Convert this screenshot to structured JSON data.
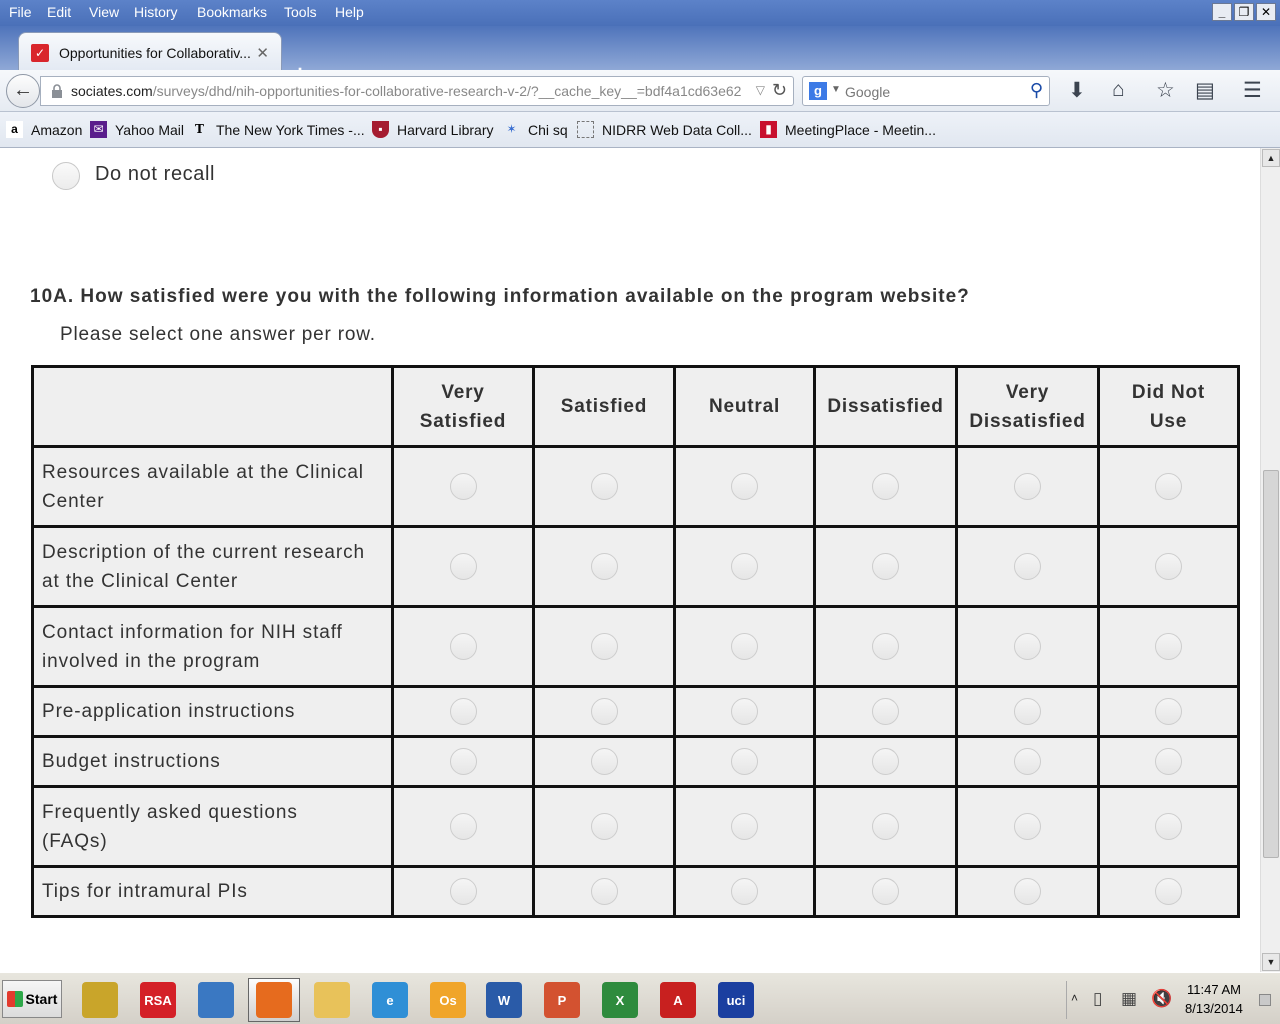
{
  "menu": {
    "items": [
      "File",
      "Edit",
      "View",
      "History",
      "Bookmarks",
      "Tools",
      "Help"
    ]
  },
  "window_controls": {
    "minimize": "_",
    "restore": "❐",
    "close": "✕"
  },
  "tab": {
    "title": "Opportunities for Collaborativ...",
    "close": "✕",
    "new_tab": "+"
  },
  "urlbar": {
    "host": "sociates.com",
    "path": "/surveys/dhd/nih-opportunities-for-collaborative-research-v-2/?__cache_key__=bdf4a1cd63e62"
  },
  "search": {
    "placeholder": "Google"
  },
  "bookmarks": [
    {
      "label": "Amazon",
      "icon": "amazon-icon"
    },
    {
      "label": "Yahoo Mail",
      "icon": "yahoo-mail-icon"
    },
    {
      "label": "The New York Times -...",
      "icon": "nyt-icon"
    },
    {
      "label": "Harvard Library",
      "icon": "harvard-shield-icon"
    },
    {
      "label": "Chi sq",
      "icon": "chi-sq-icon"
    },
    {
      "label": "NIDRR Web Data Coll...",
      "icon": "dashed-page-icon"
    },
    {
      "label": "MeetingPlace - Meetin...",
      "icon": "meetingplace-icon"
    }
  ],
  "page": {
    "previous_option": "Do not recall",
    "question": "10A. How satisfied were you with the following information available on the program website?",
    "instruction": "Please select one answer per row.",
    "columns": [
      [
        "Very",
        "Satisfied"
      ],
      [
        "Satisfied"
      ],
      [
        "Neutral"
      ],
      [
        "Dissatisfied"
      ],
      [
        "Very",
        "Dissatisfied"
      ],
      [
        "Did Not",
        "Use"
      ]
    ],
    "rows": [
      [
        "Resources available at the Clinical",
        "Center"
      ],
      [
        "Description of the current research",
        "at the Clinical Center"
      ],
      [
        "Contact information for NIH staff",
        "involved in the program"
      ],
      [
        "Pre-application instructions"
      ],
      [
        "Budget instructions"
      ],
      [
        "Frequently asked questions",
        "(FAQs)"
      ],
      [
        "Tips for intramural PIs"
      ]
    ]
  },
  "taskbar": {
    "start": "Start",
    "apps": [
      {
        "name": "lock-app-icon",
        "label": "",
        "color": "#c9a52a"
      },
      {
        "name": "rsa-icon",
        "label": "RSA",
        "color": "#d42027"
      },
      {
        "name": "network-cubes-icon",
        "label": "",
        "color": "#3a78c2"
      },
      {
        "name": "firefox-icon",
        "label": "",
        "color": "#e66b1e"
      },
      {
        "name": "folder-icon",
        "label": "",
        "color": "#e8c25a"
      },
      {
        "name": "internet-explorer-icon",
        "label": "e",
        "color": "#2f8fd6"
      },
      {
        "name": "outlook-icon",
        "label": "Os",
        "color": "#f0a52a"
      },
      {
        "name": "word-icon",
        "label": "W",
        "color": "#2a5ba8"
      },
      {
        "name": "powerpoint-icon",
        "label": "P",
        "color": "#d35230"
      },
      {
        "name": "excel-icon",
        "label": "X",
        "color": "#2e8b3d"
      },
      {
        "name": "acrobat-icon",
        "label": "A",
        "color": "#c8201f"
      },
      {
        "name": "uci-icon",
        "label": "uci",
        "color": "#1b3fa0"
      }
    ],
    "clock": {
      "time": "11:47 AM",
      "date": "8/13/2014"
    }
  }
}
